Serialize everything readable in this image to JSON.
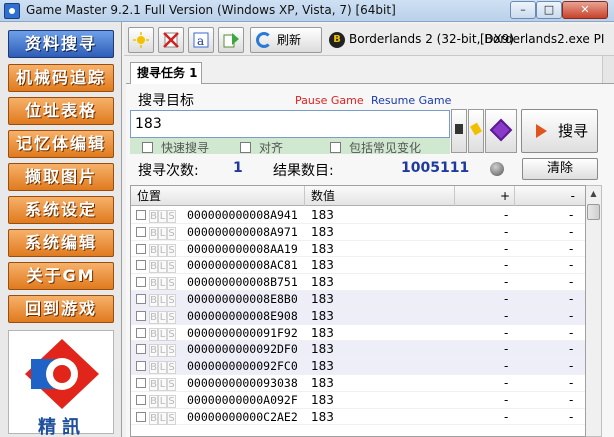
{
  "window": {
    "title": "Game Master 9.2.1 Full Version (Windows XP, Vista, 7) [64bit]",
    "min_label": "–",
    "max_label": "□",
    "close_label": "✕"
  },
  "sidebar": {
    "items": [
      {
        "label": "资料搜寻"
      },
      {
        "label": "机械码追踪"
      },
      {
        "label": "位址表格"
      },
      {
        "label": "记忆体编辑"
      },
      {
        "label": "撷取图片"
      },
      {
        "label": "系统设定"
      },
      {
        "label": "系统编辑"
      },
      {
        "label": "关于GM"
      },
      {
        "label": "回到游戏"
      }
    ],
    "logo_text": "精訊"
  },
  "toolbar": {
    "refresh_label": "刷新",
    "process_icon": "B",
    "process_name": "Borderlands 2 (32-bit, DX9)",
    "process_exe": "[Borderlands2.exe PI"
  },
  "tab": {
    "label": "搜寻任务 1"
  },
  "search": {
    "label": "搜寻目标",
    "pause_label": "Pause Game",
    "resume_label": "Resume Game",
    "value": "183",
    "button_label": "搜寻",
    "options": [
      "快速搜寻",
      "对齐",
      "包括常见变化"
    ]
  },
  "stats": {
    "count_label": "搜寻次数:",
    "count_value": "1",
    "results_label": "结果数目:",
    "results_value": "1005111",
    "clear_label": "清除"
  },
  "table": {
    "headers": [
      "位置",
      "数值",
      "+",
      "-"
    ],
    "tags": [
      "B",
      "L",
      "S"
    ],
    "rows": [
      {
        "addr": "000000000008A941",
        "value": "183",
        "plus": "-",
        "minus": "-"
      },
      {
        "addr": "000000000008A971",
        "value": "183",
        "plus": "-",
        "minus": "-"
      },
      {
        "addr": "000000000008AA19",
        "value": "183",
        "plus": "-",
        "minus": "-"
      },
      {
        "addr": "000000000008AC81",
        "value": "183",
        "plus": "-",
        "minus": "-"
      },
      {
        "addr": "000000000008B751",
        "value": "183",
        "plus": "-",
        "minus": "-"
      },
      {
        "addr": "000000000008E8B0",
        "value": "183",
        "plus": "-",
        "minus": "-"
      },
      {
        "addr": "000000000008E908",
        "value": "183",
        "plus": "-",
        "minus": "-"
      },
      {
        "addr": "0000000000091F92",
        "value": "183",
        "plus": "-",
        "minus": "-"
      },
      {
        "addr": "0000000000092DF0",
        "value": "183",
        "plus": "-",
        "minus": "-"
      },
      {
        "addr": "0000000000092FC0",
        "value": "183",
        "plus": "-",
        "minus": "-"
      },
      {
        "addr": "0000000000093038",
        "value": "183",
        "plus": "-",
        "minus": "-"
      },
      {
        "addr": "00000000000A092F",
        "value": "183",
        "plus": "-",
        "minus": "-"
      },
      {
        "addr": "00000000000C2AE2",
        "value": "183",
        "plus": "-",
        "minus": "-"
      }
    ]
  },
  "colors": {
    "sidebar_button": "#e07a1e",
    "sidebar_active": "#2d5db8",
    "pause_link": "#e02020",
    "resume_link": "#1a3aa8",
    "stat_value": "#1e3a9e",
    "options_bg": "#cfe8cf"
  },
  "icons": {
    "toolbar": [
      "new-task-icon",
      "delete-task-icon",
      "text-icon",
      "export-icon",
      "refresh-icon"
    ]
  }
}
